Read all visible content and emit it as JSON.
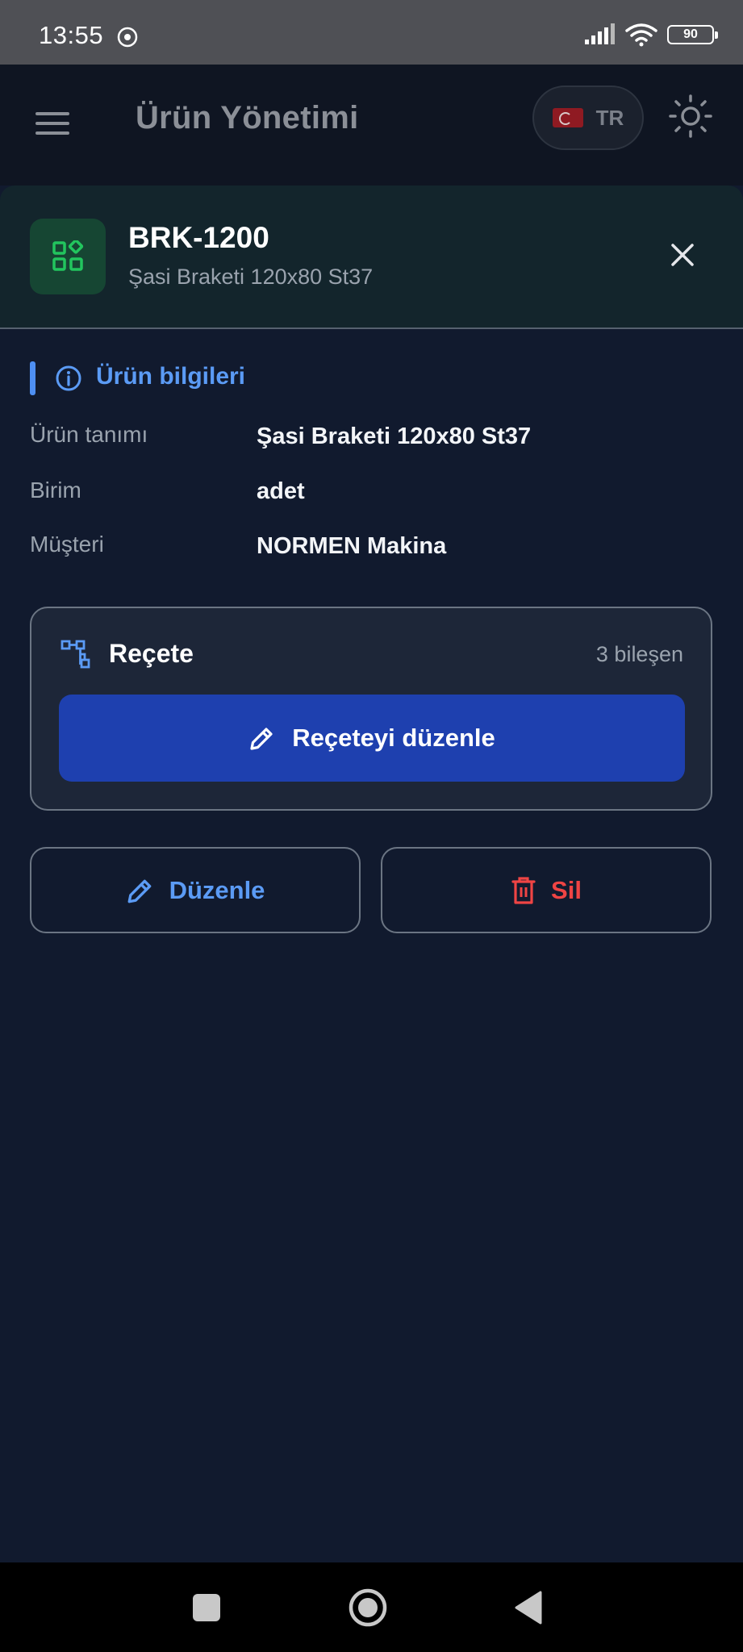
{
  "status_bar": {
    "time": "13:55",
    "battery": "90"
  },
  "app_bar": {
    "title": "Ürün Yönetimi",
    "language": "TR"
  },
  "product": {
    "code": "BRK-1200",
    "name": "Şasi Braketi 120x80 St37"
  },
  "info_section": {
    "title": "Ürün bilgileri",
    "rows": [
      {
        "label": "Ürün tanımı",
        "value": "Şasi Braketi 120x80 St37"
      },
      {
        "label": "Birim",
        "value": "adet"
      },
      {
        "label": "Müşteri",
        "value": "NORMEN Makina"
      }
    ]
  },
  "recipe": {
    "title": "Reçete",
    "count": "3 bileşen",
    "edit_label": "Reçeteyi düzenle"
  },
  "actions": {
    "edit_label": "Düzenle",
    "delete_label": "Sil"
  },
  "colors": {
    "accent": "#5b9bf5",
    "primary_button": "#1e40af",
    "danger": "#ef4444",
    "product_icon": "#22c55e"
  }
}
